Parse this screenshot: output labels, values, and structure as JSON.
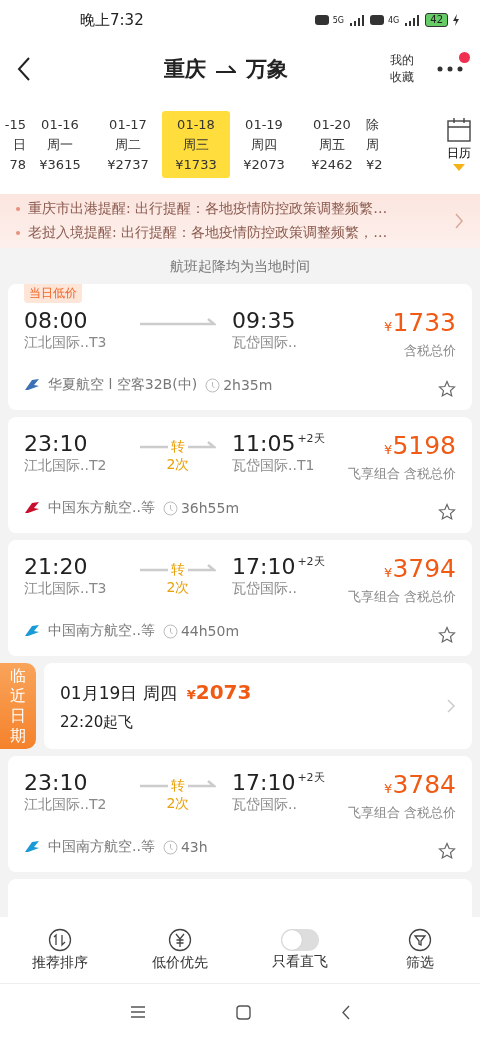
{
  "status_bar": {
    "time": "晚上7:32",
    "net1": "5G",
    "net2": "4G",
    "battery": "42"
  },
  "header": {
    "title_from": "重庆",
    "title_to": "万象",
    "favorites": "我的收藏",
    "has_notification": true
  },
  "dates": [
    {
      "date": "-15",
      "weekday": "日",
      "price": "78",
      "selected": false
    },
    {
      "date": "01-16",
      "weekday": "周一",
      "price": "¥3615",
      "selected": false
    },
    {
      "date": "01-17",
      "weekday": "周二",
      "price": "¥2737",
      "selected": false
    },
    {
      "date": "01-18",
      "weekday": "周三",
      "price": "¥1733",
      "selected": true
    },
    {
      "date": "01-19",
      "weekday": "周四",
      "price": "¥2073",
      "selected": false
    },
    {
      "date": "01-20",
      "weekday": "周五",
      "price": "¥2462",
      "selected": false
    },
    {
      "date": "除",
      "weekday": "周",
      "price": "¥2",
      "selected": false
    }
  ],
  "calendar_label": "日历",
  "notices": [
    "重庆市出港提醒: 出行提醒：各地疫情防控政策调整频繁…",
    "老挝入境提醒: 出行提醒：各地疫情防控政策调整频繁，…"
  ],
  "time_note": "航班起降均为当地时间",
  "results": [
    {
      "kind": "flight",
      "tag": "当日低价",
      "dep_time": "08:00",
      "dep_airport": "江北国际..T3",
      "arr_time": "09:35",
      "arr_airport": "瓦岱国际..",
      "currency": "¥",
      "price": "1733",
      "price_note": "含税总价",
      "airline": "华夏航空 l 空客32B(中)",
      "color": "#3b6fb6",
      "duration": "2h35m",
      "starred": false
    },
    {
      "kind": "flight",
      "dep_time": "23:10",
      "dep_airport": "江北国际..T2",
      "transfer": "转",
      "transfer_count": "2次",
      "arr_time": "11:05",
      "day_offset": "+2天",
      "arr_airport": "瓦岱国际..T1",
      "currency": "¥",
      "price": "5198",
      "price_note": "飞享组合 含税总价",
      "airline": "中国东方航空..等",
      "color": "#c8102e",
      "duration": "36h55m",
      "starred": false
    },
    {
      "kind": "flight",
      "dep_time": "21:20",
      "dep_airport": "江北国际..T3",
      "transfer": "转",
      "transfer_count": "2次",
      "arr_time": "17:10",
      "day_offset": "+2天",
      "arr_airport": "瓦岱国际..",
      "currency": "¥",
      "price": "3794",
      "price_note": "飞享组合 含税总价",
      "airline": "中国南方航空..等",
      "color": "#1a9ad6",
      "duration": "44h50m",
      "starred": false
    },
    {
      "kind": "nearby",
      "label": "临近日期",
      "date": "01月19日 周四",
      "currency": "¥",
      "price": "2073",
      "departure": "22:20起飞"
    },
    {
      "kind": "flight",
      "dep_time": "23:10",
      "dep_airport": "江北国际..T2",
      "transfer": "转",
      "transfer_count": "2次",
      "arr_time": "17:10",
      "day_offset": "+2天",
      "arr_airport": "瓦岱国际..",
      "currency": "¥",
      "price": "3784",
      "price_note": "飞享组合 含税总价",
      "airline": "中国南方航空..等",
      "color": "#1a9ad6",
      "duration": "43h",
      "starred": false
    }
  ],
  "bottom_bar": [
    {
      "kind": "sort",
      "label": "推荐排序"
    },
    {
      "kind": "price",
      "label": "低价优先"
    },
    {
      "kind": "toggle",
      "label": "只看直飞",
      "on": false
    },
    {
      "kind": "filter",
      "label": "筛选"
    }
  ]
}
